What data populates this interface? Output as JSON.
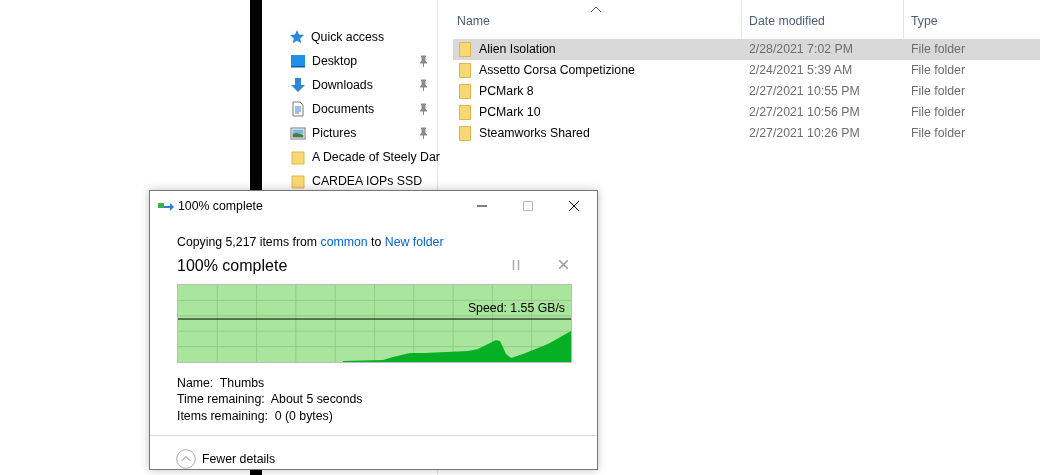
{
  "explorer": {
    "nav": [
      {
        "kind": "star",
        "label": "Quick access",
        "pinned": false
      },
      {
        "kind": "desktop",
        "label": "Desktop",
        "pinned": true
      },
      {
        "kind": "downloads",
        "label": "Downloads",
        "pinned": true
      },
      {
        "kind": "documents",
        "label": "Documents",
        "pinned": true
      },
      {
        "kind": "pictures",
        "label": "Pictures",
        "pinned": true
      },
      {
        "kind": "folder",
        "label": "A Decade of Steely Dar",
        "pinned": false
      },
      {
        "kind": "folder",
        "label": "CARDEA IOPs SSD",
        "pinned": false
      }
    ],
    "columns": [
      "Name",
      "Date modified",
      "Type"
    ],
    "rows": [
      {
        "name": "Alien Isolation",
        "date": "2/28/2021 7:02 PM",
        "type": "File folder",
        "selected": true
      },
      {
        "name": "Assetto Corsa Competizione",
        "date": "2/24/2021 5:39 AM",
        "type": "File folder",
        "selected": false
      },
      {
        "name": "PCMark 8",
        "date": "2/27/2021 10:55 PM",
        "type": "File folder",
        "selected": false
      },
      {
        "name": "PCMark 10",
        "date": "2/27/2021 10:56 PM",
        "type": "File folder",
        "selected": false
      },
      {
        "name": "Steamworks Shared",
        "date": "2/27/2021 10:26 PM",
        "type": "File folder",
        "selected": false
      }
    ]
  },
  "dialog": {
    "title": "100% complete",
    "summary": [
      {
        "kind": "text",
        "text": "Copying 5,217 items from "
      },
      {
        "kind": "link",
        "text": "common"
      },
      {
        "kind": "text",
        "text": " to "
      },
      {
        "kind": "link",
        "text": "New folder"
      }
    ],
    "heading": "100% complete",
    "progress": {
      "level": 1,
      "speed": "Speed: 1.55 GB/s"
    },
    "details": [
      "Name:  Thumbs",
      "Time remaining:  About 5 seconds",
      "Items remaining:  0 (0 bytes)"
    ],
    "toggle": "Fewer details"
  }
}
